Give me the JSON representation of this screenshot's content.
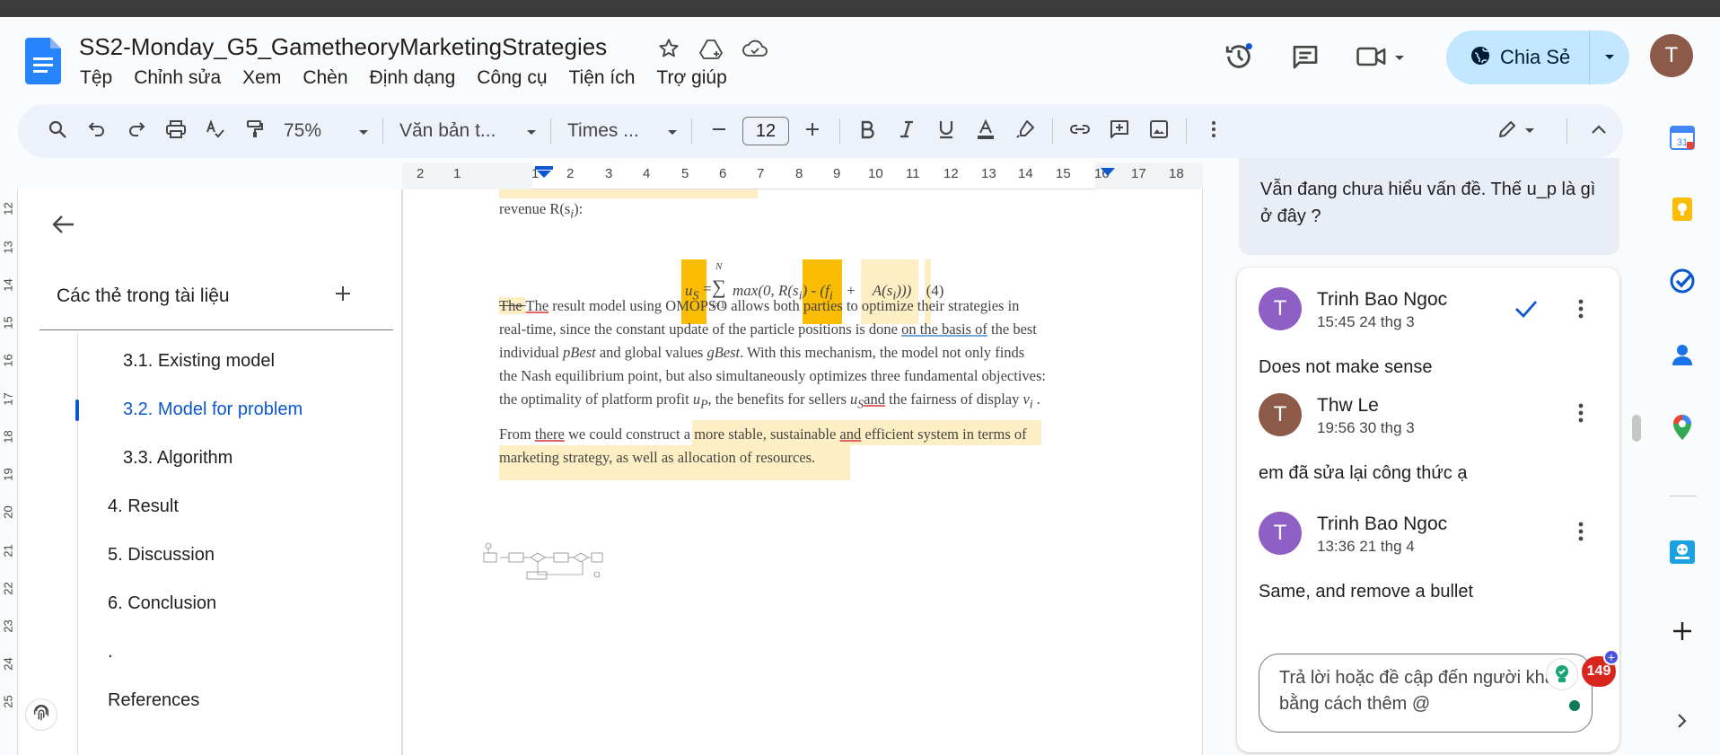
{
  "document": {
    "title": "SS2-Monday_G5_GametheoryMarketingStrategies"
  },
  "menu": [
    "Tệp",
    "Chỉnh sửa",
    "Xem",
    "Chèn",
    "Định dạng",
    "Công cụ",
    "Tiện ích",
    "Trợ giúp"
  ],
  "share": {
    "label": "Chia Sẻ"
  },
  "user": {
    "initial": "T"
  },
  "toolbar": {
    "zoom": "75%",
    "style": "Văn bản t...",
    "font": "Times ...",
    "font_size": "12"
  },
  "ruler": {
    "ticks": [
      "2",
      "1",
      "1",
      "2",
      "3",
      "4",
      "5",
      "6",
      "7",
      "8",
      "9",
      "10",
      "11",
      "12",
      "13",
      "14",
      "15",
      "16",
      "17",
      "18"
    ]
  },
  "left_ruler": {
    "ticks": [
      "12",
      "13",
      "14",
      "15",
      "16",
      "17",
      "18",
      "19",
      "20",
      "21",
      "22",
      "23",
      "24",
      "25"
    ]
  },
  "outline": {
    "heading": "Các thẻ trong tài liệu",
    "items": [
      {
        "label": "3.1. Existing model",
        "active": false
      },
      {
        "label": "3.2. Model for problem",
        "active": true
      },
      {
        "label": "3.3. Algorithm",
        "active": false
      },
      {
        "label": "4. Result",
        "active": false
      },
      {
        "label": "5. Discussion",
        "active": false
      },
      {
        "label": "6. Conclusion",
        "active": false
      },
      {
        "label": ".",
        "active": false
      },
      {
        "label": "References",
        "active": false
      }
    ]
  },
  "body": {
    "revenue_line": "revenue R(s",
    "revenue_sub": "i",
    "revenue_end": "):",
    "formula": {
      "lhs": "u",
      "lhs_sub": "S",
      "eq": "=",
      "sum_top": "N",
      "sum_bottom": "i=1",
      "part1": "max(0, R(s",
      "part1_sub": "i",
      "part2": ") - (f",
      "part2_sub": "i",
      "part3": "+",
      "part4": "A(s",
      "part4_sub": "i",
      "part5": ")))",
      "number": "(4)"
    },
    "p1_strike": "The ",
    "p1_l1_start": "The",
    "p1_l1_rest": " result model using OMOPSO allows both parties to optimize their strategies in",
    "p1_l2_a": "real-time, since the constant update of the particle positions is done ",
    "p1_l2_b": "on the basis of",
    "p1_l2_c": " the best",
    "p1_l3_a": "individual ",
    "p1_l3_pbest": "pBest",
    "p1_l3_b": " and global values ",
    "p1_l3_gbest": "gBest",
    "p1_l3_c": ". With this mechanism, the model not only finds",
    "p1_l4": "the Nash equilibrium point, but also simultaneously optimizes three fundamental objectives:",
    "p1_l5_a": "the optimality of platform profit ",
    "p1_l5_up": "u",
    "p1_l5_up_sub": "P",
    "p1_l5_b": ", the benefits for sellers ",
    "p1_l5_us": "u",
    "p1_l5_us_sub": "S",
    "p1_l5_and": "and",
    "p1_l5_c": " the fairness of display ",
    "p1_l5_vi": "v",
    "p1_l5_vi_sub": "i",
    "p1_l5_d": " .",
    "p2_l1_a": "From ",
    "p2_l1_there": "there",
    "p2_l1_b": " we could construct a more sta",
    "p2_l1_c": "ble, sustainable ",
    "p2_l1_and": "and",
    "p2_l1_d": " efficient system in terms of",
    "p2_l2": "marketing strategy, as well as allocation of resources."
  },
  "comments": {
    "previous_text": "Vẫn đang chưa hiểu vấn đề. Thế u_p là gì ở đây ?",
    "thread": [
      {
        "initial": "T",
        "author": "Trinh Bao Ngoc",
        "time": "15:45 24 thg 3",
        "text": "Does not make sense",
        "color": "#8e5fc4"
      },
      {
        "initial": "T",
        "author": "Thw Le",
        "time": "19:56 30 thg 3",
        "text": "em đã sửa lại công thức ạ",
        "color": "#8d5a4a"
      },
      {
        "initial": "T",
        "author": "Trinh Bao Ngoc",
        "time": "13:36 21 thg 4",
        "text": "Same, and remove a bullet",
        "color": "#8e5fc4"
      }
    ],
    "reply_placeholder": "Trả lời hoặc đề cập đến người khác bằng cách thêm @"
  },
  "grammar": {
    "count": "149"
  },
  "colors": {
    "accent": "#0b57d0",
    "share_bg": "#c2e7ff",
    "highlight": "#fdefc3",
    "highlight_strong": "#fbbc04"
  },
  "icons": {
    "title": [
      "star-icon",
      "move-to-drive-icon",
      "cloud-saved-icon"
    ],
    "header": [
      "version-history-icon",
      "comments-icon",
      "meet-icon"
    ],
    "side_panel": [
      "calendar-icon",
      "keep-icon",
      "tasks-icon",
      "contacts-icon",
      "maps-icon",
      "addon-icon",
      "plus-icon",
      "expand-icon"
    ]
  }
}
